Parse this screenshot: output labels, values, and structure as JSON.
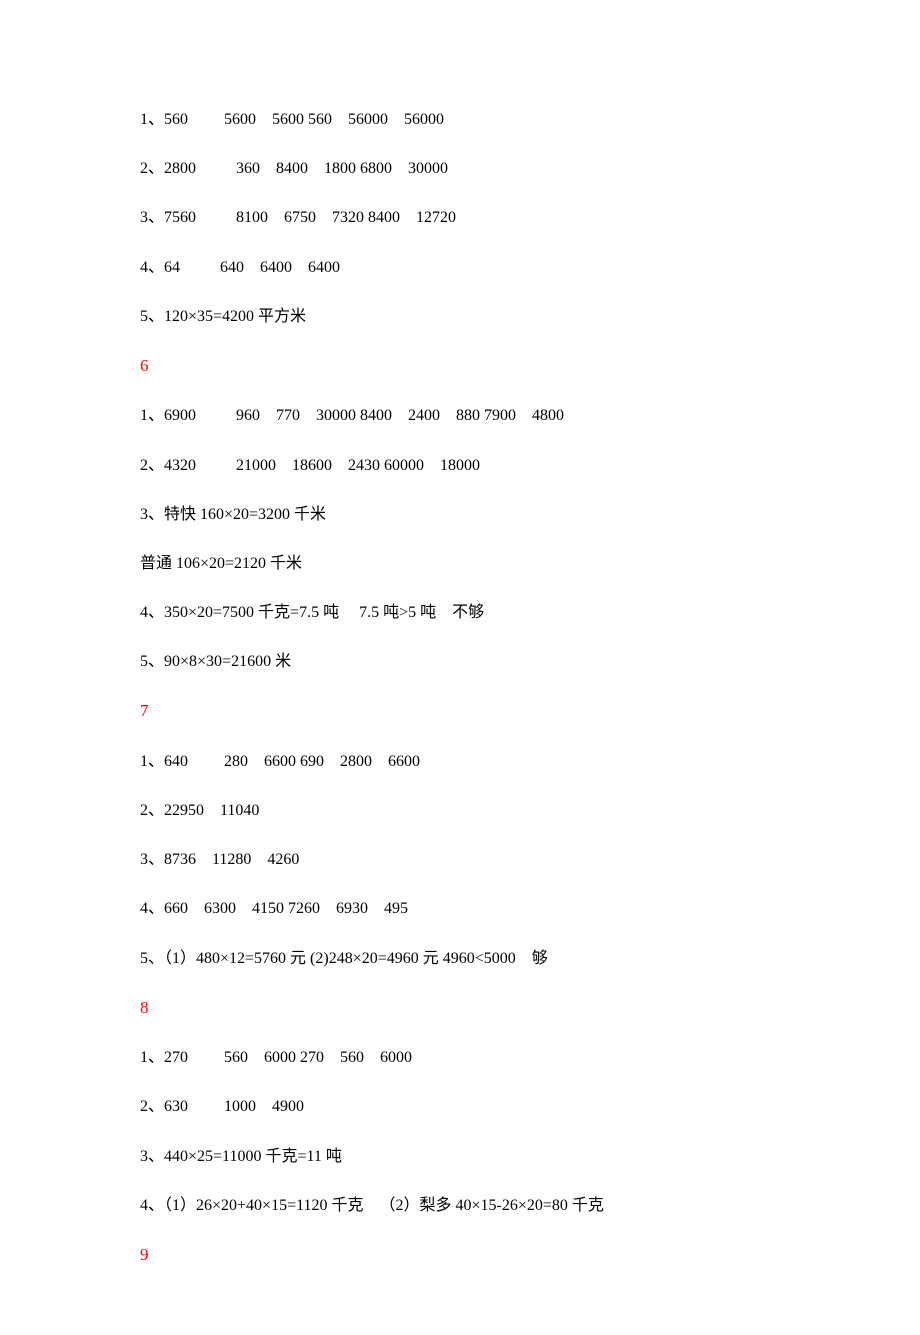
{
  "lines": [
    {
      "type": "text",
      "text": "1、560         5600    5600 560    56000    56000"
    },
    {
      "type": "text",
      "text": "2、2800          360    8400    1800 6800    30000"
    },
    {
      "type": "text",
      "text": "3、7560          8100    6750    7320 8400    12720"
    },
    {
      "type": "text",
      "text": "4、64          640    6400    6400"
    },
    {
      "type": "text",
      "text": "5、120×35=4200 平方米"
    },
    {
      "type": "section",
      "text": "6"
    },
    {
      "type": "text",
      "text": "1、6900          960    770    30000 8400    2400    880 7900    4800"
    },
    {
      "type": "text",
      "text": "2、4320          21000    18600    2430 60000    18000"
    },
    {
      "type": "text",
      "text": "3、特快 160×20=3200 千米"
    },
    {
      "type": "text",
      "text": "普通 106×20=2120 千米"
    },
    {
      "type": "text",
      "text": "4、350×20=7500 千克=7.5 吨     7.5 吨>5 吨    不够"
    },
    {
      "type": "text",
      "text": "5、90×8×30=21600 米"
    },
    {
      "type": "section",
      "text": "7"
    },
    {
      "type": "text",
      "text": "1、640         280    6600 690    2800    6600"
    },
    {
      "type": "text",
      "text": "2、22950    11040"
    },
    {
      "type": "text",
      "text": "3、8736    11280    4260"
    },
    {
      "type": "text",
      "text": "4、660    6300    4150 7260    6930    495"
    },
    {
      "type": "text",
      "text": "5、（1）480×12=5760 元 (2)248×20=4960 元 4960<5000    够"
    },
    {
      "type": "section",
      "text": "8"
    },
    {
      "type": "text",
      "text": "1、270         560    6000 270    560    6000"
    },
    {
      "type": "text",
      "text": "2、630         1000    4900"
    },
    {
      "type": "text",
      "text": "3、440×25=11000 千克=11 吨"
    },
    {
      "type": "text",
      "text": "4、（1）26×20+40×15=1120 千克    （2）梨多 40×15-26×20=80 千克"
    },
    {
      "type": "section",
      "text": "9"
    }
  ]
}
